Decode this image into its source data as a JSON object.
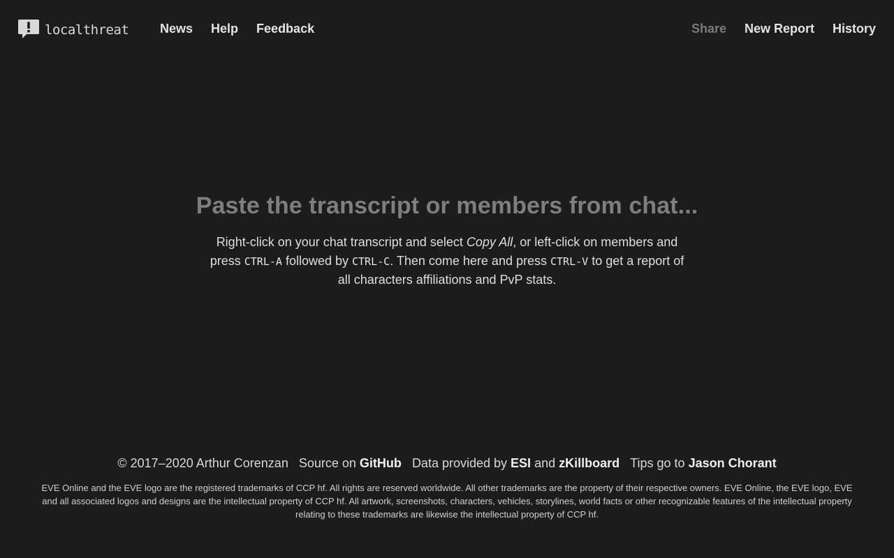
{
  "header": {
    "brand": "localthreat",
    "nav_left": [
      "News",
      "Help",
      "Feedback"
    ],
    "nav_right": {
      "share": "Share",
      "new_report": "New Report",
      "history": "History"
    }
  },
  "main": {
    "headline": "Paste the transcript or members from chat...",
    "instr": {
      "p1": "Right-click on your chat transcript and select ",
      "copy_all": "Copy All",
      "p2": ", or left-click on members and press ",
      "key_a": "CTRL-A",
      "p3": " followed by ",
      "key_c": "CTRL-C",
      "p4": ". Then come here and press ",
      "key_v": "CTRL-V",
      "p5": " to get a report of all characters affiliations and PvP stats."
    }
  },
  "footer": {
    "copyright": "© 2017–2020 Arthur Corenzan",
    "source_prefix": "Source on",
    "source_link": "GitHub",
    "data_prefix": "Data provided by",
    "esi_link": "ESI",
    "and": "and",
    "zkb_link": "zKillboard",
    "tips_prefix": "Tips go to",
    "tips_link": "Jason Chorant",
    "legal": "EVE Online and the EVE logo are the registered trademarks of CCP hf. All rights are reserved worldwide. All other trademarks are the property of their respective owners. EVE Online, the EVE logo, EVE and all associated logos and designs are the intellectual property of CCP hf. All artwork, screenshots, characters, vehicles, storylines, world facts or other recognizable features of the intellectual property relating to these trademarks are likewise the intellectual property of CCP hf."
  },
  "icons": {
    "brand_icon": "speech-bubble-exclamation-icon"
  },
  "colors": {
    "background": "#1b1c1e",
    "headline": "#7e7e80",
    "text": "#dedede",
    "disabled_link": "#7b7b7b"
  }
}
